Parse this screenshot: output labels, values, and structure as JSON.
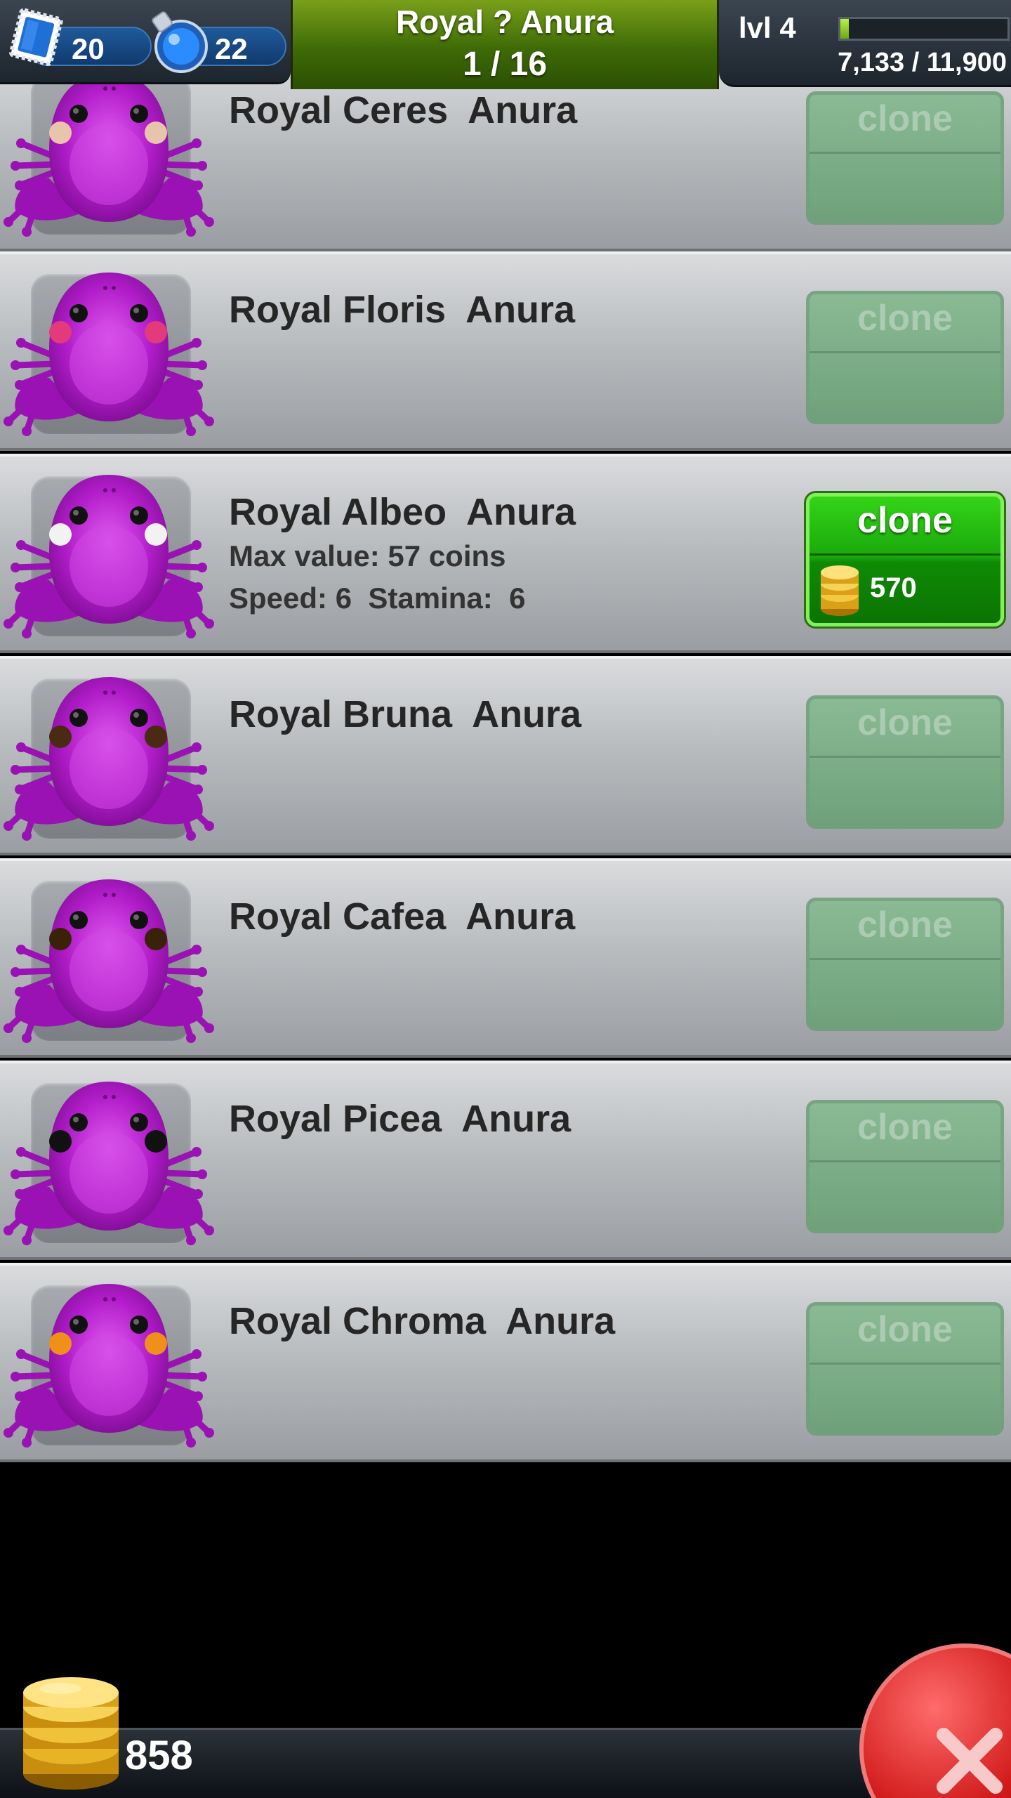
{
  "hud": {
    "stamps_count": "20",
    "potions_count": "22",
    "title": "Royal ? Anura",
    "page_count": "1 / 16",
    "level": "lvl 4",
    "xp": "7,133 / 11,900",
    "xp_progress": 0.05
  },
  "frogs": [
    {
      "name": "Royal Ceres  Anura",
      "cheek": "#e8c4ac",
      "clone": "clone"
    },
    {
      "name": "Royal Floris  Anura",
      "cheek": "#e23a7a",
      "clone": "clone"
    },
    {
      "name": "Royal Albeo  Anura",
      "cheek": "#f2f2f2",
      "clone": "clone",
      "max_value": "Max value: 57 coins",
      "stats": "Speed: 6  Stamina:  6",
      "price": "570"
    },
    {
      "name": "Royal Bruna  Anura",
      "cheek": "#4a2a12",
      "clone": "clone"
    },
    {
      "name": "Royal Cafea  Anura",
      "cheek": "#3a2208",
      "clone": "clone"
    },
    {
      "name": "Royal Picea  Anura",
      "cheek": "#111111",
      "clone": "clone"
    },
    {
      "name": "Royal Chroma  Anura",
      "cheek": "#f0901a",
      "clone": "clone"
    }
  ],
  "footer": {
    "coins_total": "858"
  },
  "icons": {
    "stamp": "blue-stamp-icon",
    "potion": "blue-potion-icon",
    "coin": "gold-coin-stack-icon",
    "close": "close-x-icon"
  },
  "colors": {
    "frog_body": "#b01cc8",
    "clone_active": "#19a80b",
    "clone_disabled": "#7fb88a",
    "title_bar": "#4f7f0c",
    "close_button": "#d11a1a"
  }
}
